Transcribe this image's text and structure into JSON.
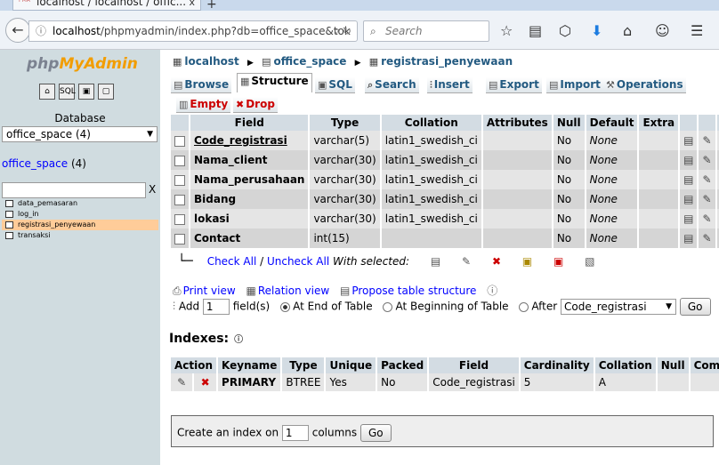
{
  "browser": {
    "tab_title": "localhost / localhost / offic...",
    "tab_favicon": "PMA",
    "tab_close": "x",
    "new_tab": "+",
    "url_host": "localhost",
    "url_path": "/phpmyadmin/index.php?db=office_space&tok",
    "search_placeholder": "Search"
  },
  "sidebar": {
    "logo_php": "php",
    "logo_myadmin": "MyAdmin",
    "database_label": "Database",
    "database_selected": "office_space (4)",
    "db_name": "office_space",
    "db_count": "(4)",
    "filter_clear": "X",
    "tables": [
      "data_pemasaran",
      "log_in",
      "registrasi_penyewaan",
      "transaksi"
    ],
    "active_table_index": 2
  },
  "breadcrumb": {
    "server": "localhost",
    "database": "office_space",
    "table": "registrasi_penyewaan"
  },
  "tabs": {
    "browse": "Browse",
    "structure": "Structure",
    "sql": "SQL",
    "search": "Search",
    "insert": "Insert",
    "export": "Export",
    "import": "Import",
    "operations": "Operations",
    "empty": "Empty",
    "drop": "Drop"
  },
  "structure": {
    "headers": [
      "Field",
      "Type",
      "Collation",
      "Attributes",
      "Null",
      "Default",
      "Extra"
    ],
    "rows": [
      {
        "field": "Code_registrasi",
        "type": "varchar(5)",
        "collation": "latin1_swedish_ci",
        "attributes": "",
        "null": "No",
        "default": "None",
        "extra": ""
      },
      {
        "field": "Nama_client",
        "type": "varchar(30)",
        "collation": "latin1_swedish_ci",
        "attributes": "",
        "null": "No",
        "default": "None",
        "extra": ""
      },
      {
        "field": "Nama_perusahaan",
        "type": "varchar(30)",
        "collation": "latin1_swedish_ci",
        "attributes": "",
        "null": "No",
        "default": "None",
        "extra": ""
      },
      {
        "field": "Bidang",
        "type": "varchar(30)",
        "collation": "latin1_swedish_ci",
        "attributes": "",
        "null": "No",
        "default": "None",
        "extra": ""
      },
      {
        "field": "lokasi",
        "type": "varchar(30)",
        "collation": "latin1_swedish_ci",
        "attributes": "",
        "null": "No",
        "default": "None",
        "extra": ""
      },
      {
        "field": "Contact",
        "type": "int(15)",
        "collation": "",
        "attributes": "",
        "null": "No",
        "default": "None",
        "extra": ""
      }
    ],
    "check_all": "Check All",
    "uncheck_all": "Uncheck All",
    "with_selected": "With selected:"
  },
  "actions": {
    "print_view": "Print view",
    "relation_view": "Relation view",
    "propose_structure": "Propose table structure",
    "add_label": "Add",
    "add_count": "1",
    "fields_label": "field(s)",
    "at_end": "At End of Table",
    "at_beginning": "At Beginning of Table",
    "after_label": "After",
    "after_selected": "Code_registrasi",
    "go": "Go"
  },
  "indexes": {
    "title": "Indexes:",
    "headers": [
      "Action",
      "Keyname",
      "Type",
      "Unique",
      "Packed",
      "Field",
      "Cardinality",
      "Collation",
      "Null",
      "Comment"
    ],
    "rows": [
      {
        "keyname": "PRIMARY",
        "type": "BTREE",
        "unique": "Yes",
        "packed": "No",
        "field": "Code_registrasi",
        "cardinality": "5",
        "collation": "A",
        "null": "",
        "comment": ""
      }
    ],
    "create_prefix": "Create an index on",
    "create_count": "1",
    "create_suffix": "columns",
    "go": "Go"
  },
  "colors": {
    "link": "#235a81",
    "active_table": "#ffcc99",
    "sidebar_bg": "#d0dce0",
    "header_bg": "#d3dce3"
  }
}
